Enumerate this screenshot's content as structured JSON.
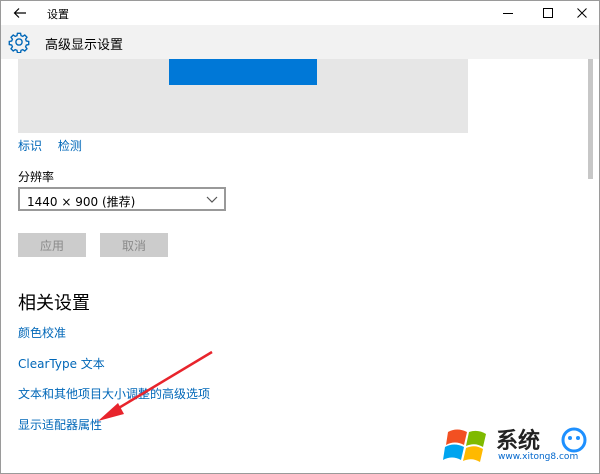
{
  "window": {
    "title": "设置",
    "minimize_icon": "minimize-icon",
    "maximize_icon": "maximize-icon",
    "close_icon": "close-icon"
  },
  "header": {
    "title": "高级显示设置",
    "icon": "gear-icon"
  },
  "display": {
    "identify_label": "标识",
    "detect_label": "检测",
    "accent_color": "#0078d7"
  },
  "resolution": {
    "label": "分辨率",
    "value": "1440 × 900 (推荐)"
  },
  "buttons": {
    "apply": "应用",
    "cancel": "取消"
  },
  "related": {
    "title": "相关设置",
    "links": [
      "颜色校准",
      "ClearType 文本",
      "文本和其他项目大小调整的高级选项",
      "显示适配器属性"
    ]
  },
  "annotation": {
    "arrow_color": "#e8242c"
  },
  "watermark": {
    "brand": "系统",
    "url": "www.xitong8.com"
  }
}
